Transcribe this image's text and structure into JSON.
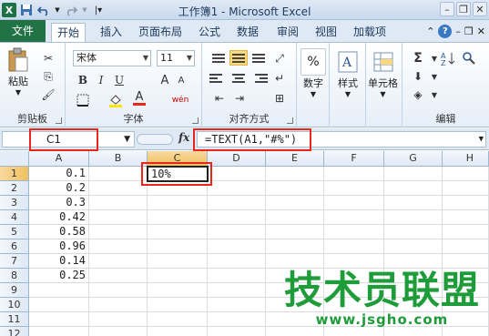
{
  "window": {
    "title": "工作簿1 - Microsoft Excel",
    "app_icon": "X",
    "qat_icons": [
      "save-icon",
      "undo-icon",
      "redo-icon",
      "customize-icon"
    ],
    "controls": [
      "minimize-icon",
      "restore-icon",
      "close-icon"
    ]
  },
  "tabs": {
    "file": "文件",
    "items": [
      "开始",
      "插入",
      "页面布局",
      "公式",
      "数据",
      "审阅",
      "视图",
      "加载项"
    ],
    "active": "开始"
  },
  "ribbon": {
    "clipboard": {
      "paste": "粘贴",
      "label": "剪贴板"
    },
    "font": {
      "name": "宋体",
      "size": "11",
      "bold": "B",
      "italic": "I",
      "underline": "U",
      "font_color_letter": "A",
      "grow": "A",
      "shrink": "A",
      "wen": "wén",
      "label": "字体"
    },
    "alignment": {
      "label": "对齐方式"
    },
    "number": {
      "button": "数字",
      "percent": "%"
    },
    "styles": {
      "button": "样式"
    },
    "cells": {
      "button": "单元格"
    },
    "editing": {
      "label": "编辑",
      "sigma": "Σ"
    }
  },
  "formula_bar": {
    "name_box": "C1",
    "fx": "fx",
    "formula": "=TEXT(A1,\"#%\")"
  },
  "grid": {
    "columns": [
      "A",
      "B",
      "C",
      "D",
      "E",
      "F",
      "G",
      "H"
    ],
    "selected_column": "C",
    "rows": [
      "1",
      "2",
      "3",
      "4",
      "5",
      "6",
      "7",
      "8",
      "9",
      "10",
      "11",
      "12"
    ],
    "selected_row": "1",
    "column_a": [
      "0.1",
      "0.2",
      "0.3",
      "0.42",
      "0.58",
      "0.96",
      "0.14",
      "0.25"
    ],
    "active_cell": {
      "ref": "C1",
      "value": "10%"
    }
  },
  "watermark": {
    "title": "技术员联盟",
    "url": "www.jsgho.com"
  },
  "colors": {
    "file_tab": "#217346",
    "highlight": "#e8261b",
    "watermark": "#1f9c3a",
    "selected_header": "#f1c15f"
  }
}
